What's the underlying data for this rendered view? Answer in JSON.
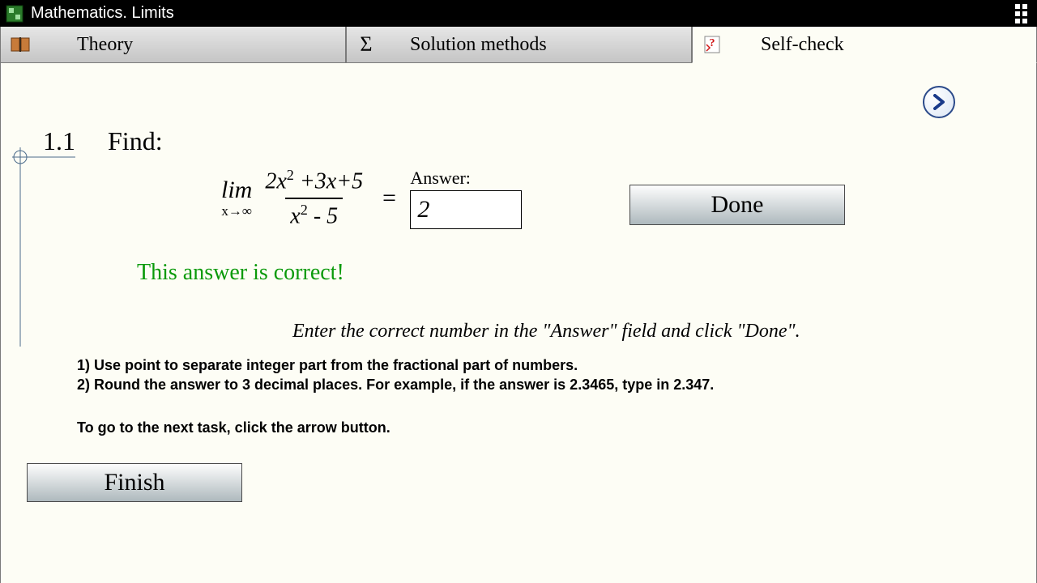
{
  "titlebar": {
    "title": "Mathematics. Limits"
  },
  "tabs": {
    "theory": {
      "label": "Theory"
    },
    "solution": {
      "label": "Solution methods"
    },
    "selfcheck": {
      "label": "Self-check"
    }
  },
  "problem": {
    "number": "1.1",
    "title": "Find:",
    "limit": {
      "symbol": "lim",
      "subscript": "x→∞",
      "numerator": "2x² +3x+5",
      "denominator": "x² - 5",
      "equals": "="
    },
    "answer": {
      "label": "Answer:",
      "value": "2"
    }
  },
  "buttons": {
    "done": "Done",
    "finish": "Finish"
  },
  "feedback": "This answer is correct!",
  "instruction": "Enter the correct number in the \"Answer\" field and click \"Done\".",
  "hints": {
    "line1": "1) Use point to separate integer part from the fractional part of numbers.",
    "line2": "2) Round the answer to 3 decimal places. For example, if the answer is 2.3465, type in 2.347."
  },
  "next_hint": "To go to the next task, click the arrow button."
}
